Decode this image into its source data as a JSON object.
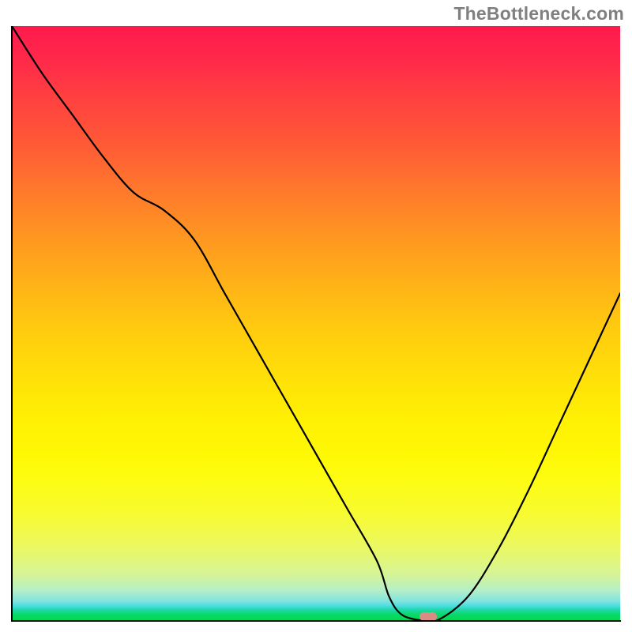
{
  "watermark": "TheBottleneck.com",
  "colors": {
    "curve": "#000000",
    "marker": "#d88c84",
    "axis": "#000000"
  },
  "chart_data": {
    "type": "line",
    "title": "",
    "xlabel": "",
    "ylabel": "",
    "xlim": [
      0,
      100
    ],
    "ylim": [
      0,
      100
    ],
    "curve": {
      "name": "bottleneck-curve",
      "x": [
        0,
        5,
        10,
        15,
        20,
        25,
        30,
        35,
        40,
        45,
        50,
        55,
        60,
        62,
        64,
        67,
        70,
        75,
        80,
        85,
        90,
        95,
        100
      ],
      "y": [
        100,
        92,
        85,
        78,
        72,
        69,
        64,
        55,
        46,
        37,
        28,
        19,
        10,
        4,
        1,
        0,
        0,
        4,
        12,
        22,
        33,
        44,
        55
      ]
    },
    "marker": {
      "x": 68.5,
      "y": 0
    },
    "gradient_stops": [
      {
        "pos": 0,
        "color": "#ff1a4c"
      },
      {
        "pos": 0.5,
        "color": "#ffd000"
      },
      {
        "pos": 0.78,
        "color": "#fefc08"
      },
      {
        "pos": 1.0,
        "color": "#04d852"
      }
    ]
  }
}
